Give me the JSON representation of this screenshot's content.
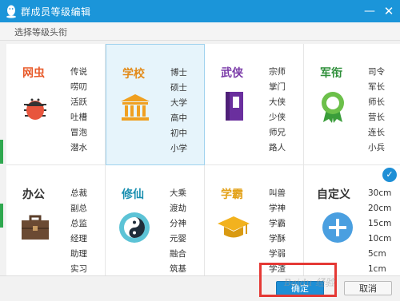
{
  "window": {
    "title": "群成员等级编辑",
    "minimize_glyph": "—",
    "close_glyph": "✕"
  },
  "subtitle": "选择等级头衔",
  "categories": [
    {
      "name": "网虫",
      "color": "#e85a2a",
      "icon": "bug-icon",
      "levels": [
        "传说",
        "唠叨",
        "活跃",
        "吐槽",
        "冒泡",
        "潜水"
      ]
    },
    {
      "name": "学校",
      "color": "#e38b1a",
      "icon": "school-building-icon",
      "levels": [
        "博士",
        "硕士",
        "大学",
        "高中",
        "初中",
        "小学"
      ]
    },
    {
      "name": "武侠",
      "color": "#7a3aa8",
      "icon": "martial-book-icon",
      "levels": [
        "宗师",
        "掌门",
        "大侠",
        "少侠",
        "师兄",
        "路人"
      ]
    },
    {
      "name": "军衔",
      "color": "#2f8f3a",
      "icon": "medal-icon",
      "levels": [
        "司令",
        "军长",
        "师长",
        "营长",
        "连长",
        "小兵"
      ]
    },
    {
      "name": "办公",
      "color": "#333333",
      "icon": "briefcase-icon",
      "levels": [
        "总裁",
        "副总",
        "总监",
        "经理",
        "助理",
        "实习"
      ]
    },
    {
      "name": "修仙",
      "color": "#1a8fb0",
      "icon": "yin-yang-icon",
      "levels": [
        "大乘",
        "渡劫",
        "分神",
        "元婴",
        "融合",
        "筑基"
      ]
    },
    {
      "name": "学霸",
      "color": "#e3a21a",
      "icon": "graduation-cap-icon",
      "levels": [
        "叫兽",
        "学神",
        "学霸",
        "学酥",
        "学弱",
        "学渣"
      ]
    },
    {
      "name": "自定义",
      "color": "#333333",
      "icon": "plus-circle-icon",
      "levels": [
        "30cm",
        "20cm",
        "15cm",
        "10cm",
        "5cm",
        "1cm"
      ]
    }
  ],
  "selected": "学校",
  "checked": "自定义",
  "check_glyph": "✓",
  "buttons": {
    "ok": "确定",
    "cancel": "取消"
  },
  "watermark": "Baidu 经验"
}
